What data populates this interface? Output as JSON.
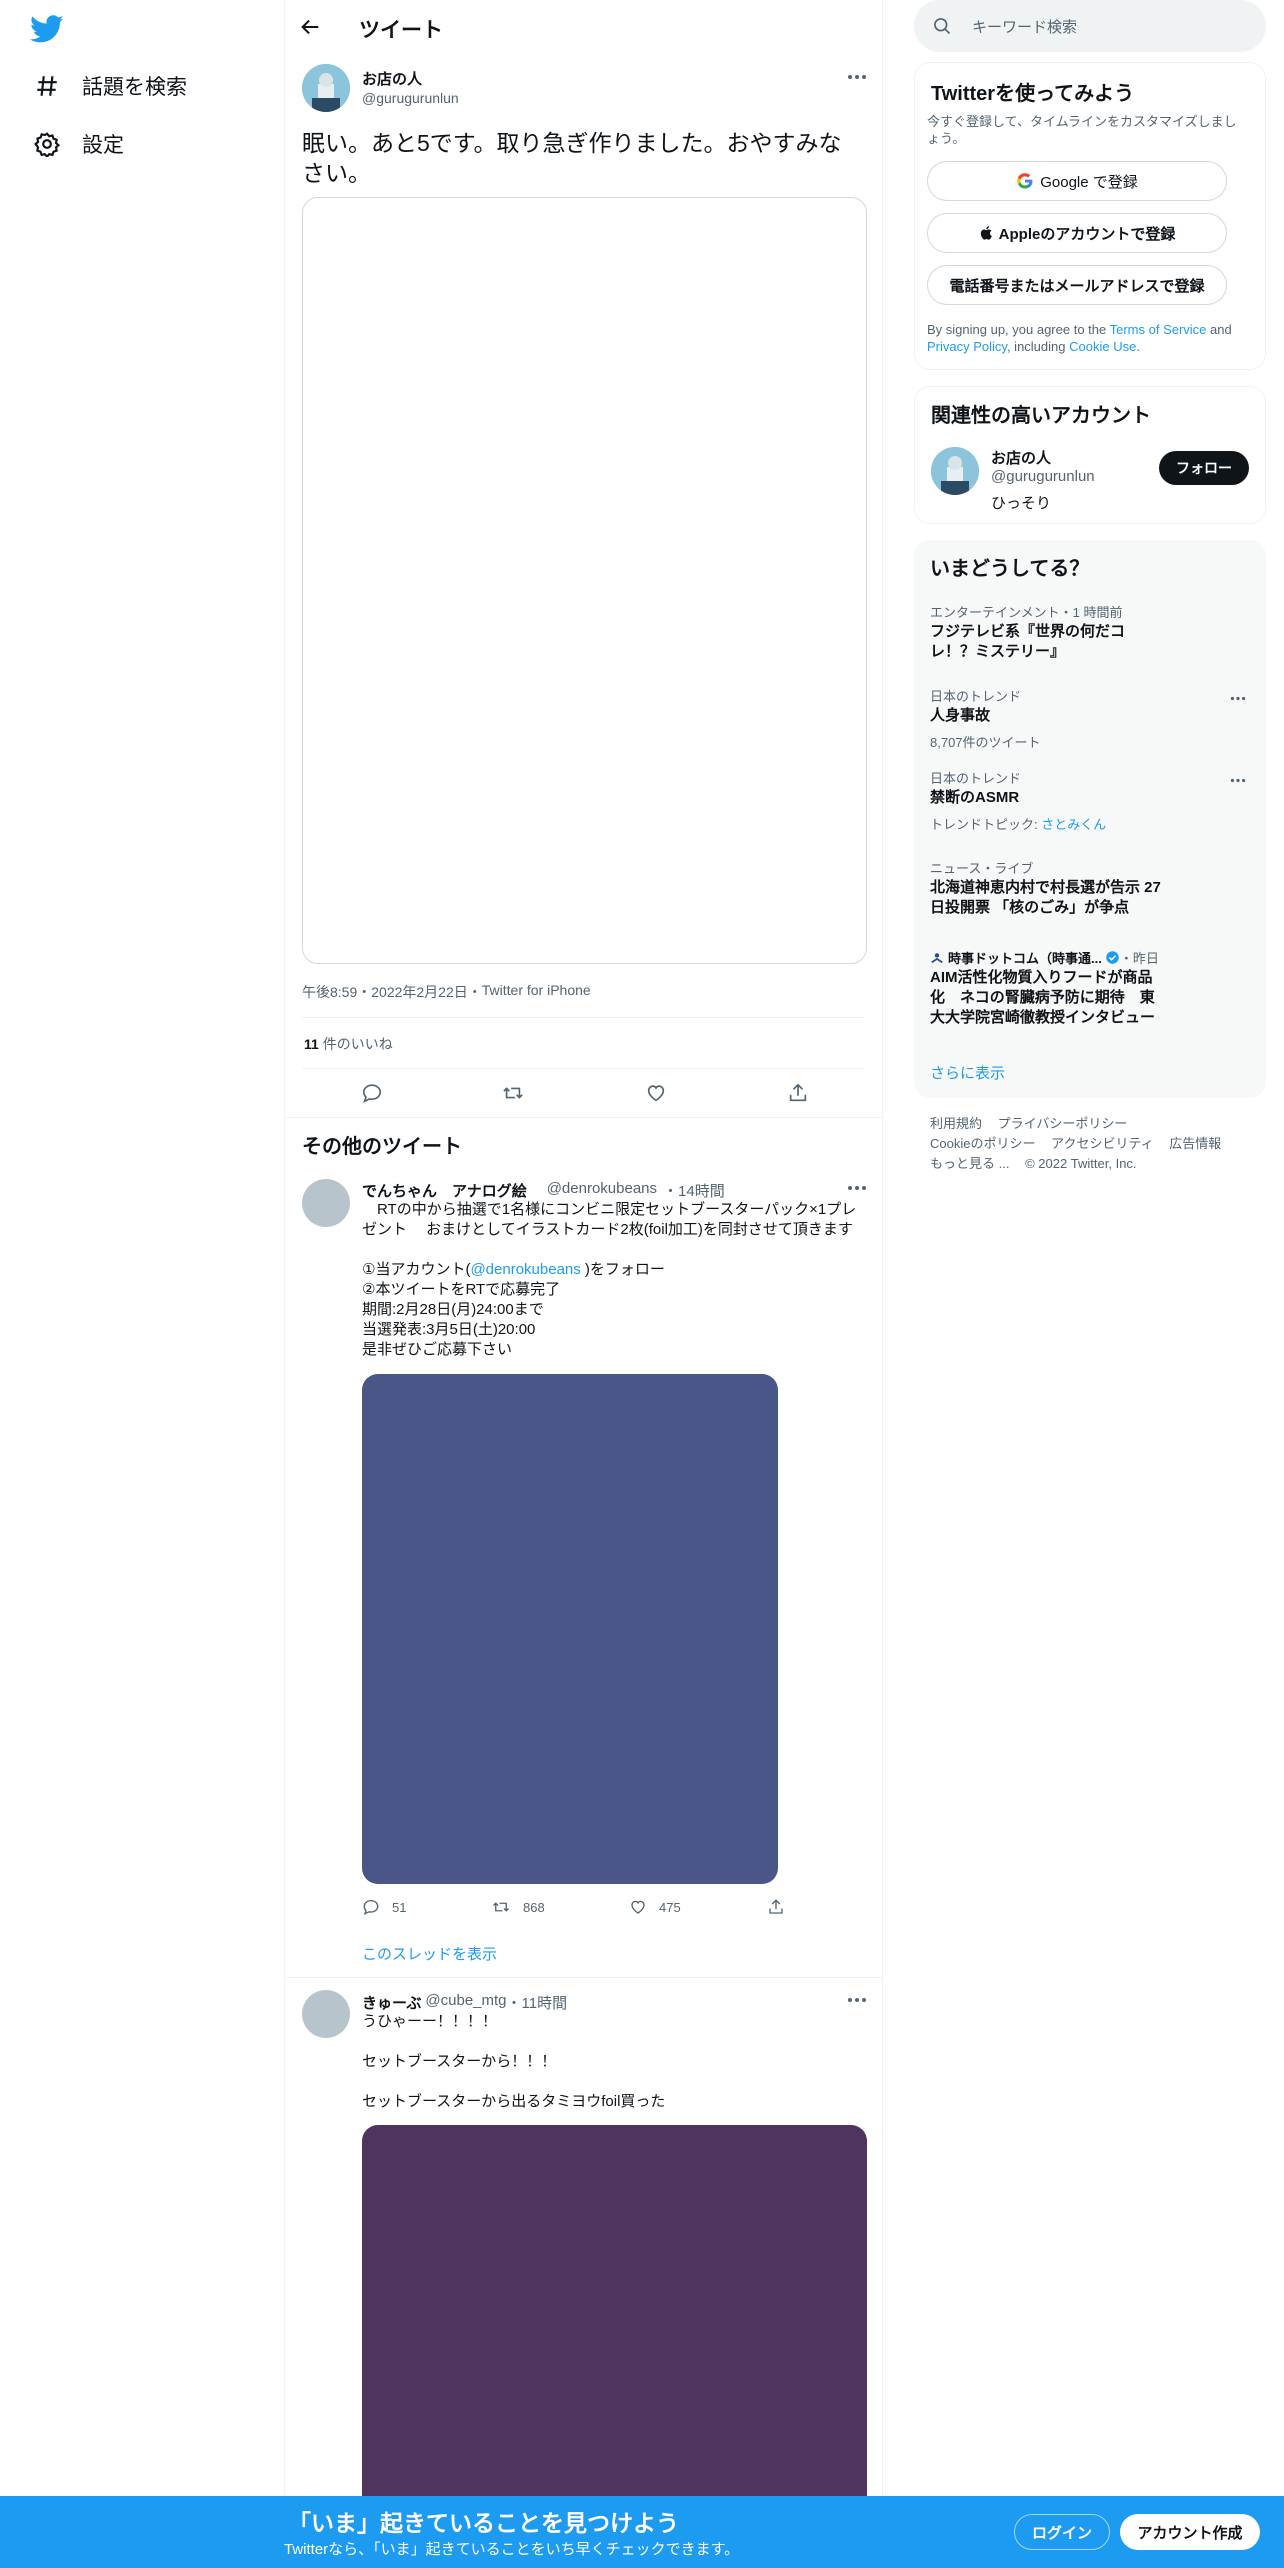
{
  "nav": {
    "items": [
      {
        "label": "話題を検索",
        "icon": "hashtag-icon"
      },
      {
        "label": "設定",
        "icon": "gear-icon"
      }
    ]
  },
  "header": {
    "title": "ツイート"
  },
  "tweet": {
    "name": "お店の人",
    "handle": "@gurugurunlun",
    "text": "眠い。あと5です。取り急ぎ作りました。おやすみなさい。",
    "time": "午後8:59",
    "date": "2022年2月22日",
    "source": "Twitter for iPhone",
    "likes_count": "11",
    "likes_label": "件のいいね"
  },
  "more_tweets": {
    "heading": "その他のツイート",
    "items": [
      {
        "name": "でんちゃん　アナログ絵",
        "handle": "@denrokubeans",
        "time": "14時間",
        "line1": "　RTの中から抽選で1名様にコンビニ限定セットブースターパック×1プレゼント　 おまけとしてイラストカード2枚(foil加工)を同封させて頂きます",
        "line2_pre": "①当アカウント(",
        "line2_link": "@denrokubeans",
        "line2_post": " )をフォロー",
        "line3": "②本ツイートをRTで応募完了",
        "line4": "期間:2月28日(月)24:00まで",
        "line5": "当選発表:3月5日(土)20:00",
        "line6": "是非ぜひご応募下さい",
        "replies": "51",
        "retweets": "868",
        "likes": "475",
        "thread_link": "このスレッドを表示",
        "media_color": "#4a5588"
      },
      {
        "name": "きゅーぶ",
        "handle": "@cube_mtg",
        "time": "11時間",
        "line1": "うひゃーー！！！！",
        "line2": "セットブースターから！！！",
        "line3": "セットブースターから出るタミヨウfoil買った",
        "media_color": "#4e345e"
      }
    ]
  },
  "search": {
    "placeholder": "キーワード検索"
  },
  "signup": {
    "title": "Twitterを使ってみよう",
    "subtitle": "今すぐ登録して、タイムラインをカスタマイズしましょう。",
    "google": "Google で登録",
    "apple": "Appleのアカウントで登録",
    "phone": "電話番号またはメールアドレスで登録",
    "legal_pre": "By signing up, you agree to the ",
    "terms": "Terms of Service",
    "and": " and ",
    "privacy": "Privacy Policy",
    "including": ", including ",
    "cookie": "Cookie Use",
    "period": "."
  },
  "related": {
    "title": "関連性の高いアカウント",
    "name": "お店の人",
    "handle": "@gurugurunlun",
    "bio": "ひっそり",
    "follow": "フォロー"
  },
  "trends": {
    "title": "いまどうしてる？",
    "items": [
      {
        "label": "エンターテインメント・1 時間前",
        "title": "フジテレビ系『世界の何だコレ！？ミステリー』"
      },
      {
        "label": "日本のトレンド",
        "title": "人身事故",
        "sub": "8,707件のツイート"
      },
      {
        "label": "日本のトレンド",
        "title": "禁断のASMR",
        "sub_pre": "トレンドトピック: ",
        "sub_link": "さとみくん"
      },
      {
        "label": "ニュース・ライブ",
        "title": "北海道神恵内村で村長選が告示 27日投開票 「核のごみ」が争点"
      },
      {
        "label_name": "時事ドットコム（時事通...",
        "label_time": "・昨日",
        "title": "AIM活性化物質入りフードが商品化　ネコの腎臓病予防に期待　東大大学院宮崎徹教授インタビュー"
      }
    ],
    "show_more": "さらに表示"
  },
  "footer": {
    "links": [
      "利用規約",
      "プライバシーポリシー",
      "Cookieのポリシー",
      "アクセシビリティ",
      "広告情報",
      "もっと見る ..."
    ],
    "copyright": "© 2022 Twitter, Inc."
  },
  "banner": {
    "title": "「いま」起きていることを見つけよう",
    "subtitle": "Twitterなら、「いま」起きていることをいち早くチェックできます。",
    "login": "ログイン",
    "signup": "アカウント作成"
  },
  "colors": {
    "accent": "#1d9bf0",
    "text": "#0f1419",
    "muted": "#536471"
  }
}
